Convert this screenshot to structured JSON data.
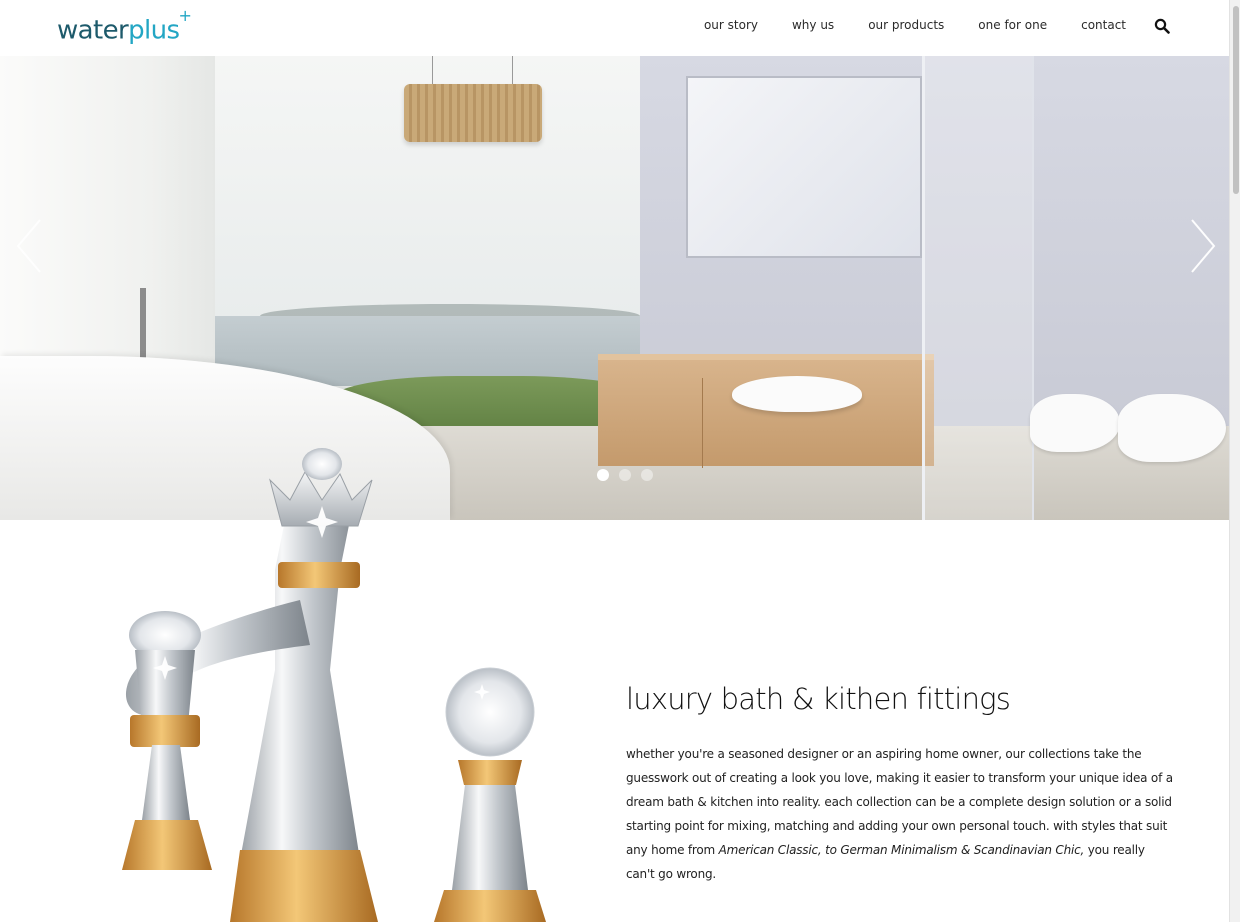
{
  "header": {
    "logo": {
      "word": "water",
      "accent": "plus",
      "mark": "+"
    },
    "nav": [
      {
        "label": "our story"
      },
      {
        "label": "why us"
      },
      {
        "label": "our products"
      },
      {
        "label": "one for one"
      },
      {
        "label": "contact"
      }
    ],
    "search_icon": "search-icon"
  },
  "hero": {
    "prev_icon": "chevron-left-icon",
    "next_icon": "chevron-right-icon",
    "slides_total": 3,
    "active_slide": 1
  },
  "intro": {
    "title": "luxury bath & kithen fittings",
    "paragraph_start": "whether you're a seasoned designer or an aspiring home owner, our collections take the guesswork out of creating a look you love, making it easier to transform your unique idea of a dream bath & kitchen into reality. each collection can be a complete design solution or a solid starting point for mixing, matching and adding your own personal touch. with styles that suit any home from ",
    "paragraph_italic": "American Classic, to German Minimalism & Scandinavian Chic,",
    "paragraph_end": " you really can't go wrong."
  },
  "colors": {
    "logo_dark": "#1d5a6b",
    "logo_accent": "#23a6c4",
    "chrome": "#c8ccd0",
    "gold": "#e0a548"
  }
}
